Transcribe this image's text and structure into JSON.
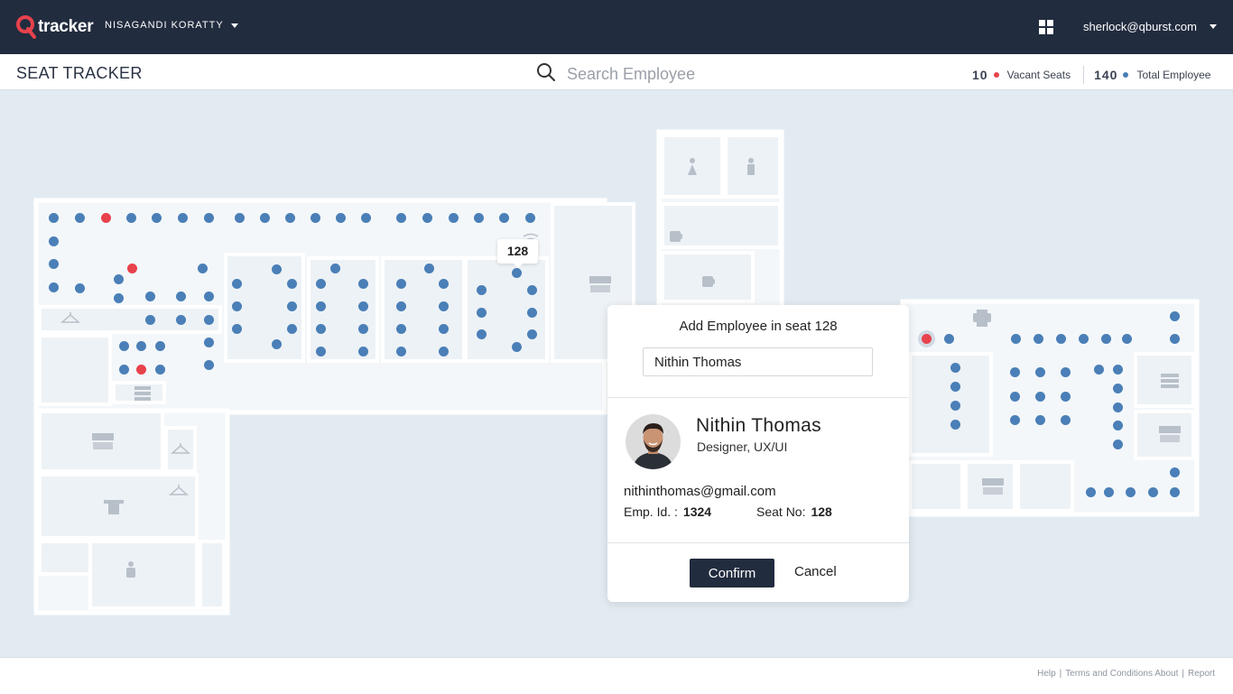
{
  "header": {
    "brand": "tracker",
    "organization": "NISAGANDI KORATTY",
    "user_email": "sherlock@qburst.com"
  },
  "subheader": {
    "page_title": "SEAT TRACKER",
    "search_placeholder": "Search Employee",
    "vacant_count": "10",
    "vacant_label": "Vacant Seats",
    "total_count": "140",
    "total_label": "Total Employee"
  },
  "colors": {
    "header_bg": "#222c3f",
    "occupied_seat": "#4a7fb7",
    "vacant_seat": "#e8424c",
    "floor_bg": "#e3ebf2"
  },
  "floor": {
    "selected_seat": "128",
    "room_icons": [
      "female-restroom-icon",
      "male-restroom-icon",
      "coffee-icon",
      "coffee-icon",
      "conference-room-icon",
      "printer-icon",
      "server-rack-icon",
      "coat-hanger-icon",
      "gym-icon",
      "meditation-icon"
    ]
  },
  "modal": {
    "title": "Add Employee in seat 128",
    "input_value": "Nithin Thomas",
    "employee_name": "Nithin Thomas",
    "employee_role": "Designer, UX/UI",
    "employee_email": "nithinthomas@gmail.com",
    "emp_id_label": "Emp. Id. :",
    "emp_id_value": "1324",
    "seat_no_label": "Seat No:",
    "seat_no_value": "128",
    "confirm_label": "Confirm",
    "cancel_label": "Cancel"
  },
  "footer": {
    "links": [
      "Help",
      "Terms and Conditions",
      "About",
      "Report"
    ]
  }
}
